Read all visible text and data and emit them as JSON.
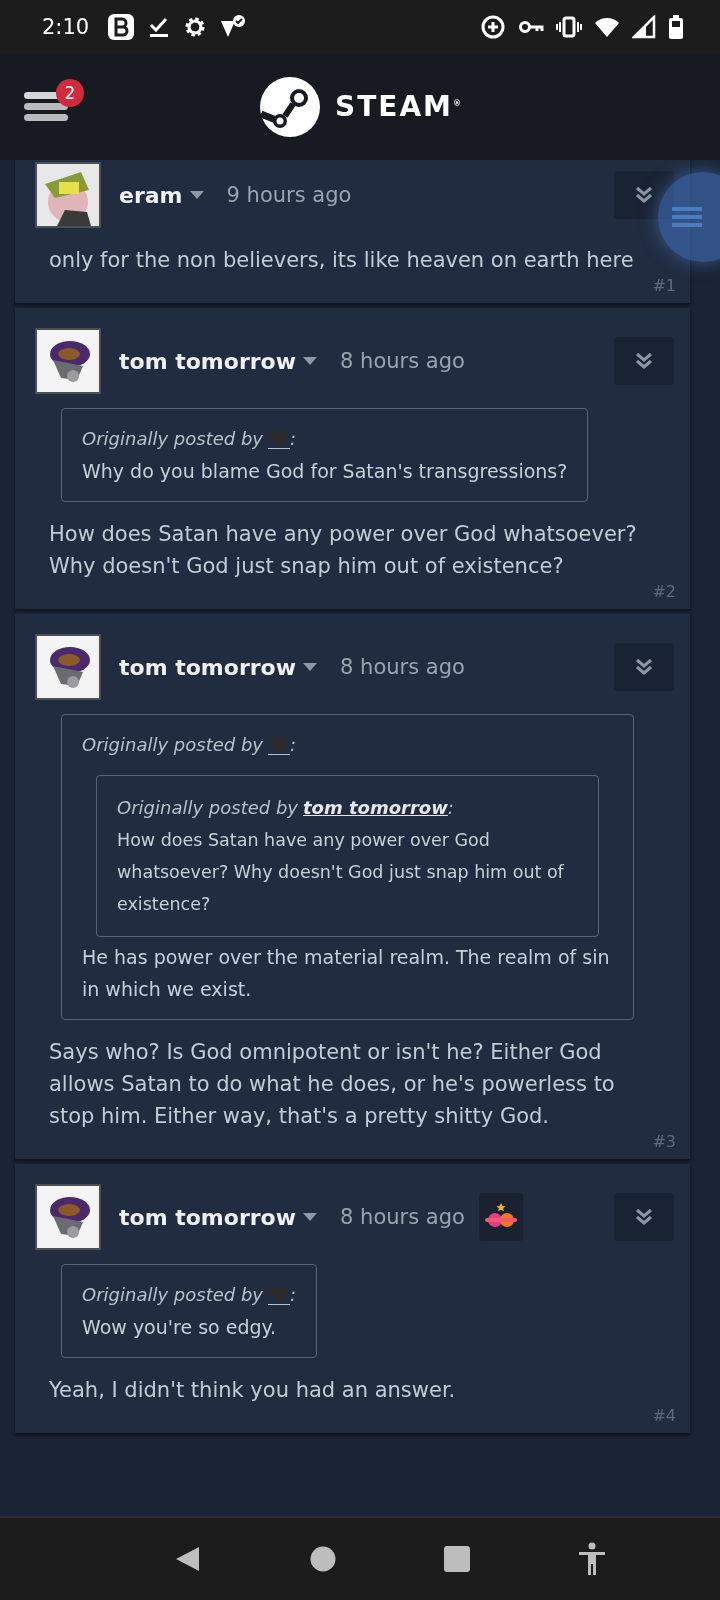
{
  "status_bar": {
    "time": "2:10"
  },
  "header": {
    "menu_badge": "2",
    "logo_text": "STEAM$^{®}$"
  },
  "posts": [
    {
      "author": "eram",
      "time": "9 hours ago",
      "award": false,
      "body": "only for the non believers, its like heaven on earth here",
      "number": "#1"
    },
    {
      "author": "tom tomorrow",
      "time": "8 hours ago",
      "award": false,
      "quote": {
        "prefix": "Originally posted by",
        "suffix": ":",
        "text": "Why do you blame God for Satan's transgressions?"
      },
      "body": "How does Satan have any power over God whatsoever? Why doesn't God just snap him out of existence?",
      "number": "#2"
    },
    {
      "author": "tom tomorrow",
      "time": "8 hours ago",
      "award": false,
      "quote": {
        "prefix": "Originally posted by",
        "suffix": ":",
        "quote": {
          "prefix": "Originally posted by",
          "author": "tom tomorrow",
          "suffix": ":",
          "text": "How does Satan have any power over God whatsoever? Why doesn't God just snap him out of existence?"
        },
        "text": "He has power over the material realm. The realm of sin in which we exist."
      },
      "body": "Says who? Is God omnipotent or isn't he? Either God allows Satan to do what he does, or he's powerless to stop him. Either way, that's a pretty shitty God.",
      "number": "#3"
    },
    {
      "author": "tom tomorrow",
      "time": "8 hours ago",
      "award": true,
      "quote": {
        "prefix": "Originally posted by",
        "suffix": ":",
        "text": "Wow you're so edgy."
      },
      "body": "Yeah, I didn't think you had an answer.",
      "number": "#4"
    }
  ]
}
